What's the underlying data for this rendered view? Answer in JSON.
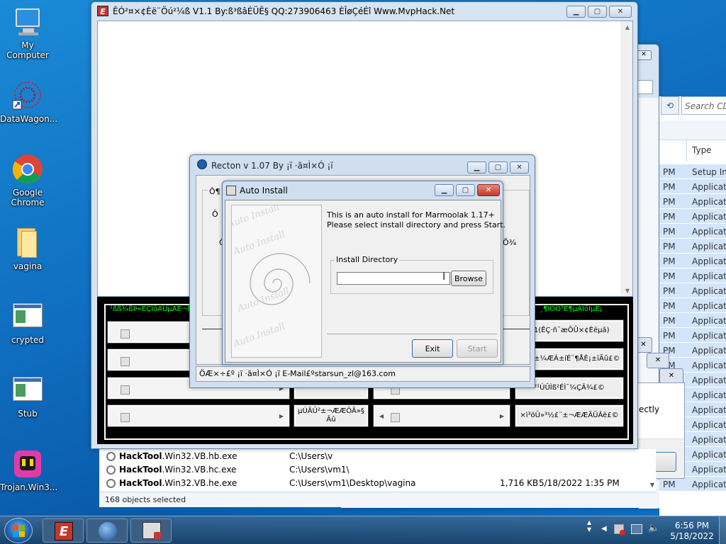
{
  "desktop": {
    "icons": [
      {
        "label": "My Computer"
      },
      {
        "label": "DataWagon..."
      },
      {
        "label": "Google Chrome"
      },
      {
        "label": "vagina"
      },
      {
        "label": "crypted"
      },
      {
        "label": "Stub"
      },
      {
        "label": "Trojan.Win3..."
      }
    ]
  },
  "mvp_window": {
    "title": "ÊÓ²¤×¢Èë¨Öú²¼ß  V1.1      By:ß³ßâÉÜÊ§  QQ:273906463   ÈÎøÇéÉî    Www.MvpHack.Net",
    "green_left": "¹ßß¾ßÞ»ÈÇÍòÄÜµÄË¬ÈëÇ",
    "green_right": "¸¶ÌÖÒ³Ê¶µÄÌóÌµÈ¡",
    "buttons": [
      "µÚÃÛ²±¬ÆÆÖÃ»§ Âû",
      "¶1(ÊÇ·ñ¯æÕÛ×¢Èëµã)",
      "¿ÉÝ²±¼ÆÁ±íÉ¯¶ÅÈ¡±ïÃû£©",
      "²¹ÚÛÌß²ÉÌ¯¼ÇÂ¾£©",
      "×ì³öÛ»³½£¨±¬ÆÆÃÜÂë£©"
    ]
  },
  "recton_window": {
    "title": "Recton v 1.07    By  ¡ï ·ã¤Ì×Ó ¡ï",
    "left_labels": [
      "Ô¶",
      "Ô",
      "Ô"
    ],
    "right_label": "Ö¾",
    "status": "ÖÆ×÷£º ¡ï ·ã¤Ì×Ó ¡ï     E-Mail£ºstarsun_zl@163.com"
  },
  "auto_install": {
    "title": "Auto Install",
    "line1": "This is an auto install for Marmoolak 1.17+",
    "line2": "Please select install directory and press Start.",
    "group_label": "Install Directory",
    "directory_value": "",
    "browse_label": "Browse",
    "exit_label": "Exit",
    "start_label": "Start",
    "watermark": "Auto Install"
  },
  "explorer": {
    "search_placeholder": "Search CD",
    "column_type": "Type",
    "rows_time": [
      "PM",
      "PM",
      "PM",
      "PM",
      "PM",
      "PM",
      "PM",
      "PM",
      "PM",
      "PM",
      "PM",
      "PM",
      "PM",
      "PM",
      "PM",
      "PM",
      "PM",
      "PM",
      "PM",
      "PM",
      "PM",
      "PM"
    ],
    "rows_type": [
      "Setup Inf",
      "Applicati",
      "Applicati",
      "Applicati",
      "Applicati",
      "Applicati",
      "Applicati",
      "Applicati",
      "Applicati",
      "Applicati",
      "Applicati",
      "Applicati",
      "Applicati",
      "Applicati",
      "Applicati",
      "Applicati",
      "Applicati",
      "Applicati",
      "Applicati",
      "Applicati",
      "Applicati",
      "Applicati"
    ],
    "files": [
      {
        "name_bold": "HackTool",
        "name_rest": ".Win32.VB.hb.exe",
        "path": "C:\\Users\\v",
        "size": "",
        "date": ""
      },
      {
        "name_bold": "HackTool",
        "name_rest": ".Win32.VB.hc.exe",
        "path": "C:\\Users\\vm1\\",
        "size": "",
        "date": ""
      },
      {
        "name_bold": "HackTool",
        "name_rest": ".Win32.VB.he.exe",
        "path": "C:\\Users\\vm1\\Desktop\\vagina",
        "size": "1,716 KB",
        "date": "5/18/2022 1:35 PM"
      }
    ],
    "status": "168 objects selected"
  },
  "dialog": {
    "text": "ectly",
    "ok_label": "OK"
  },
  "taskbar": {
    "time": "6:56 PM",
    "date": "5/18/2022"
  },
  "colors": {
    "desktop_blue": "#0f6cbf",
    "hack_green": "#00ff00",
    "hack_black": "#000000"
  }
}
